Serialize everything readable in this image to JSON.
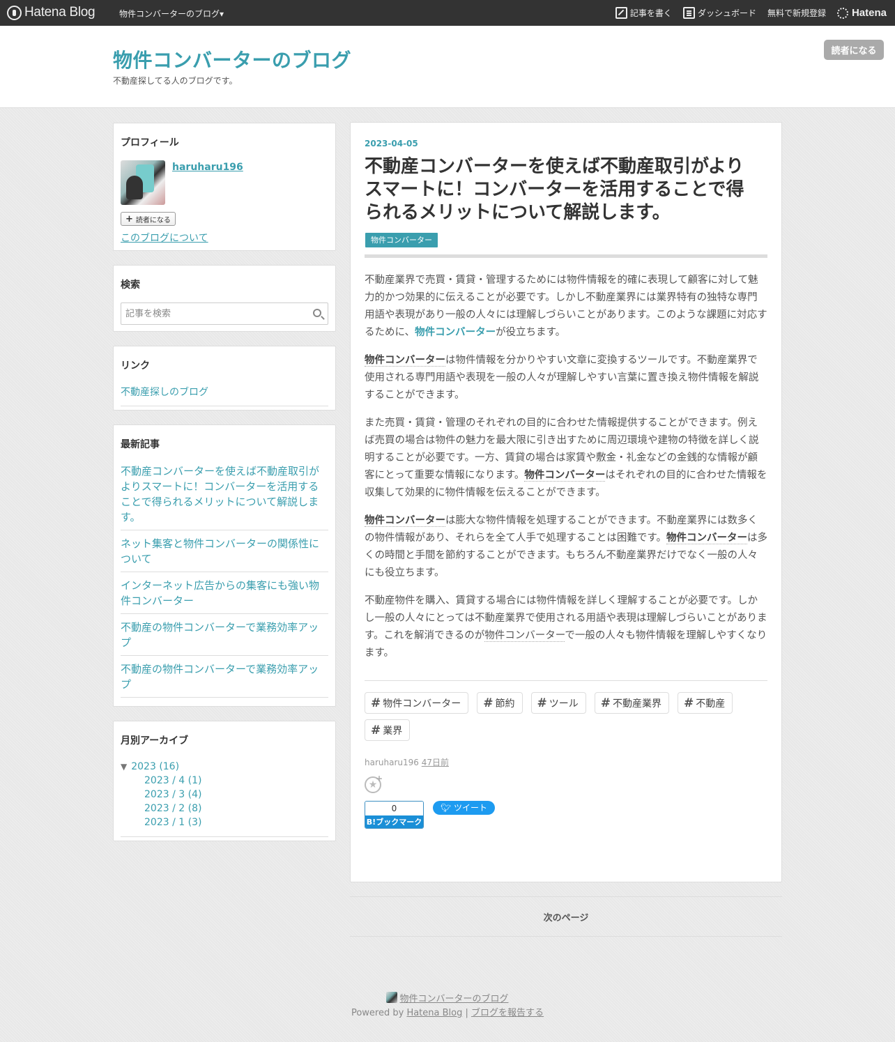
{
  "topbar": {
    "logo": "Hatena Blog",
    "blog_menu": "物件コンバーターのブログ▾",
    "write": "記事を書く",
    "dashboard": "ダッシュボード",
    "signup": "無料で新規登録",
    "hatena": "Hatena"
  },
  "header": {
    "title": "物件コンバーターのブログ",
    "description": "不動産探してる人のブログです。",
    "subscribe": "読者になる"
  },
  "sidebar": {
    "profile": {
      "heading": "プロフィール",
      "name": "haruharu196",
      "subscribe": "読者になる",
      "about": "このブログについて"
    },
    "search": {
      "heading": "検索",
      "placeholder": "記事を検索"
    },
    "links": {
      "heading": "リンク",
      "items": [
        "不動産探しのブログ"
      ]
    },
    "recent": {
      "heading": "最新記事",
      "items": [
        "不動産コンバーターを使えば不動産取引がよりスマートに！コンバーターを活用することで得られるメリットについて解説します。",
        "ネット集客と物件コンバーターの関係性について",
        "インターネット広告からの集客にも強い物件コンバーター",
        "不動産の物件コンバーターで業務効率アップ",
        "不動産の物件コンバーターで業務効率アップ"
      ]
    },
    "archive": {
      "heading": "月別アーカイブ",
      "year_toggle": "▼",
      "year": "2023 (16)",
      "months": [
        "2023 / 4 (1)",
        "2023 / 3 (4)",
        "2023 / 2 (8)",
        "2023 / 1 (3)"
      ]
    }
  },
  "entry": {
    "date": "2023-04-05",
    "title": "不動産コンバーターを使えば不動産取引がよりスマートに！コンバーターを活用することで得られるメリットについて解説します。",
    "category": "物件コンバーター",
    "p1_a": "不動産業界で売買・賃貸・管理するためには物件情報を的確に表現して顧客に対して魅力的かつ効果的に伝えることが必要です。しかし不動産業界には業界特有の独特な専門用語や表現があり一般の人々には理解しづらいことがあります。このような課題に対応するために、",
    "p1_link": "物件コンバーター",
    "p1_b": "が役立ちます。",
    "p2_kw": "物件コンバーター",
    "p2_b": "は物件情報を分かりやすい文章に変換するツールです。不動産業界で使用される専門用語や表現を一般の人々が理解しやすい言葉に置き換え物件情報を解説することができます。",
    "p3_a": "また売買・賃貸・管理のそれぞれの目的に合わせた情報提供することができます。例えば売買の場合は物件の魅力を最大限に引き出すために周辺環境や建物の特徴を詳しく説明することが必要です。一方、賃貸の場合は家賃や敷金・礼金などの金銭的な情報が顧客にとって重要な情報になります。",
    "p3_kw": "物件コンバーター",
    "p3_b": "はそれぞれの目的に合わせた情報を収集して効果的に物件情報を伝えることができます。",
    "p4_kw1": "物件コンバーター",
    "p4_a": "は膨大な物件情報を処理することができます。不動産業界には数多くの物件情報があり、それらを全て人手で処理することは困難です。",
    "p4_kw2": "物件コンバーター",
    "p4_b": "は多くの時間と手間を節約することができます。もちろん不動産業界だけでなく一般の人々にも役立ちます。",
    "p5_a": "不動産物件を購入、賃貸する場合には物件情報を詳しく理解することが必要です。しかし一般の人々にとっては不動産業界で使用される用語や表現は理解しづらいことがあります。これを解消できるのが",
    "p5_kw": "物件コンバーター",
    "p5_b": "で一般の人々も物件情報を理解しやすくなります。",
    "tags": [
      "物件コンバーター",
      "節約",
      "ツール",
      "不動産業界",
      "不動産",
      "業界"
    ],
    "author": "haruharu196",
    "ago": "47日前",
    "bookmark_count": "0",
    "bookmark_label": "B!ブックマーク",
    "tweet_label": "ツイート"
  },
  "pager": {
    "next": "次のページ"
  },
  "footer": {
    "blog_link": "物件コンバーターのブログ",
    "powered_by": "Powered by",
    "hatena_blog": "Hatena Blog",
    "divider": "|",
    "report": "ブログを報告する"
  }
}
